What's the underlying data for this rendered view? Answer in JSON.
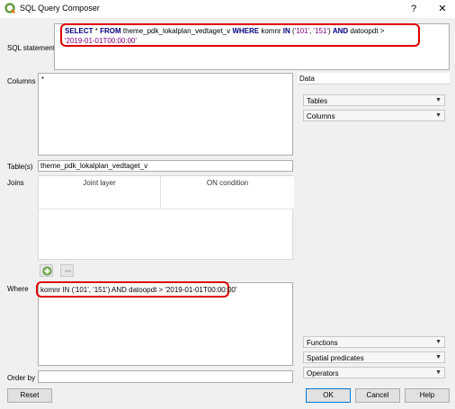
{
  "window": {
    "title": "SQL Query Composer",
    "help_label": "?",
    "close_label": "✕"
  },
  "sql": {
    "label": "SQL statement",
    "select_kw": "SELECT",
    "star": " * ",
    "from_kw": "FROM",
    "table": " theme_pdk_lokalplan_vedtaget_v ",
    "where_kw": "WHERE",
    "col1": " komnr ",
    "in_kw": "IN",
    "open": " (",
    "val1": "'101'",
    "comma": ", ",
    "val2": "'151'",
    "close": ") ",
    "and_kw": "AND",
    "col2": " datoopdt >",
    "date": "'2019-01-01T00:00:00'"
  },
  "columns": {
    "label": "Columns",
    "value": "*"
  },
  "tables": {
    "label": "Table(s)",
    "value": "theme_pdk_lokalplan_vedtaget_v"
  },
  "joins": {
    "label": "Joins",
    "headers": [
      "Joint layer",
      "ON condition"
    ]
  },
  "join_buttons": {
    "add_icon": "add-join-icon",
    "remove_icon": "remove-join-icon"
  },
  "where": {
    "label": "Where",
    "value": "komnr IN ('101', '151') AND datoopdt > '2019-01-01T00:00:00'"
  },
  "order_by": {
    "label": "Order by",
    "value": ""
  },
  "data_panel": {
    "label": "Data",
    "tables_dropdown": "Tables",
    "columns_dropdown": "Columns",
    "functions_dropdown": "Functions",
    "spatial_dropdown": "Spatial predicates",
    "operators_dropdown": "Operators"
  },
  "buttons": {
    "reset": "Reset",
    "ok": "OK",
    "cancel": "Cancel",
    "help": "Help"
  },
  "colors": {
    "highlight_border": "#e00000",
    "keyword": "#000080",
    "string": "#800080"
  }
}
